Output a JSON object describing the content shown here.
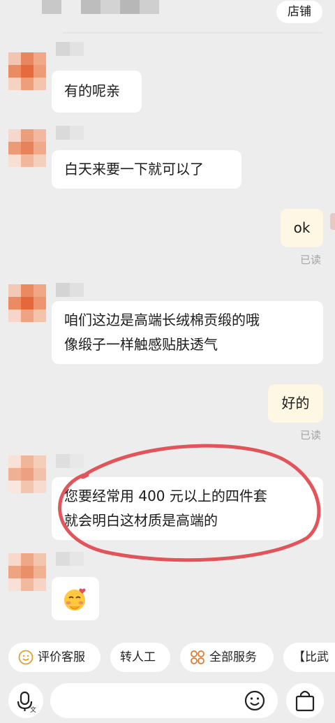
{
  "header": {
    "shop_label": "店铺"
  },
  "messages": [
    {
      "side": "left",
      "lines": [
        "有的呢亲"
      ]
    },
    {
      "side": "left",
      "lines": [
        "白天来要一下就可以了"
      ]
    },
    {
      "side": "right",
      "lines": [
        "ok"
      ],
      "status": "已读"
    },
    {
      "side": "left",
      "lines": [
        "咱们这边是高端长绒棉贡缎的哦",
        "像缎子一样触感贴肤透气"
      ]
    },
    {
      "side": "right",
      "lines": [
        "好的"
      ],
      "status": "已读"
    },
    {
      "side": "left",
      "lines": [
        "您要经常用 400 元以上的四件套",
        "就会明白这材质是高端的"
      ]
    },
    {
      "side": "left",
      "emoji": "😊"
    }
  ],
  "quick_replies": [
    {
      "label": "评价客服",
      "icon": "smile-icon"
    },
    {
      "label": "转人工"
    },
    {
      "label": "全部服务",
      "icon": "grid-icon"
    },
    {
      "label": "【比武"
    }
  ],
  "input_bar": {
    "icons": [
      "voice-icon",
      "emoji-icon",
      "shopping-bag-icon"
    ]
  },
  "colors": {
    "background": "#ededed",
    "bubble_left": "#ffffff",
    "bubble_right": "#fdf7e4",
    "annotation_circle": "#e0474c"
  }
}
